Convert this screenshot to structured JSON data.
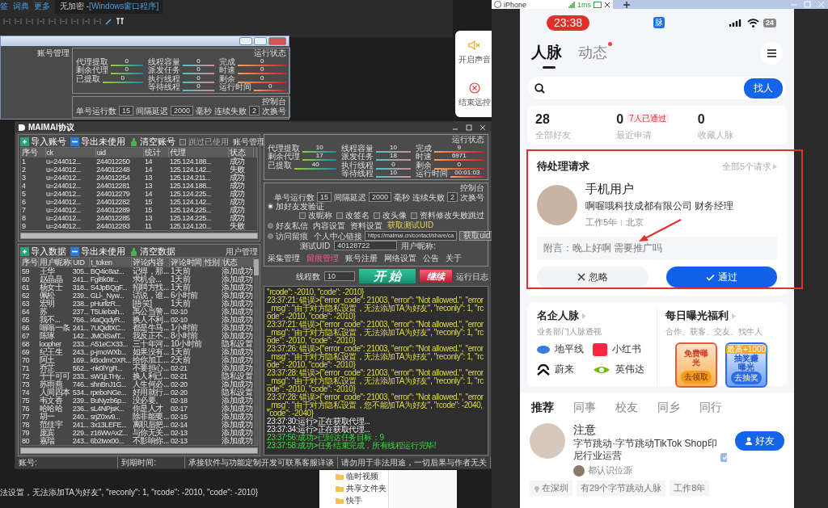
{
  "editor": {
    "menu": [
      "签",
      "词典",
      "更多"
    ],
    "title_prefix": "无加密 - ",
    "title_project": "[Windows窗口程序]"
  },
  "back_window": {
    "section_label": "账号管理",
    "status_title": "运行状态",
    "meters": [
      [
        {
          "label": "代理提取",
          "value": "0"
        },
        {
          "label": "剩余代理",
          "value": "0"
        },
        {
          "label": "已提取",
          "value": "0"
        }
      ],
      [
        {
          "label": "线程容量",
          "value": "0"
        },
        {
          "label": "派发任务",
          "value": "0"
        },
        {
          "label": "执行线程",
          "value": "0"
        },
        {
          "label": "等待线程",
          "value": "0"
        }
      ],
      [
        {
          "label": "完成",
          "value": "0"
        },
        {
          "label": "时速",
          "value": "0"
        },
        {
          "label": "剩余",
          "value": "0"
        },
        {
          "label": "运行时间",
          "value": "0"
        }
      ]
    ],
    "console_title": "控制台",
    "run_count": {
      "label": "单号运行数",
      "value": "15"
    },
    "delay": {
      "label": "间隔延迟",
      "value": "2000",
      "unit": "毫秒"
    },
    "fail": {
      "label": "连续失败",
      "value": "2",
      "unit": "次换号"
    }
  },
  "side_panel": [
    {
      "label": "开启声音",
      "kind": "sound"
    },
    {
      "label": "结束远控",
      "kind": "stop"
    }
  ],
  "maimai": {
    "title": "MAIMAI协议",
    "accounts": {
      "section_label": "账号管理",
      "toolbar": [
        {
          "label": "导入账号",
          "kind": "import"
        },
        {
          "label": "导出未使用",
          "kind": "export"
        },
        {
          "label": "清空账号",
          "kind": "clear"
        }
      ],
      "skip_used": {
        "label": "跳过已使用",
        "checked": false
      },
      "columns": [
        "序号",
        "ck",
        "uid",
        "统计",
        "代理",
        "状态"
      ],
      "rows": [
        [
          "1",
          "u=244012...",
          "244012250",
          "14",
          "125.124.188...",
          "成功"
        ],
        [
          "2",
          "u=244012...",
          "244012248",
          "14",
          "125.124.142...",
          "失败"
        ],
        [
          "3",
          "u=244012...",
          "244012254",
          "13",
          "125.124.211...",
          "成功"
        ],
        [
          "4",
          "u=244012...",
          "244012281",
          "13",
          "125.124.188...",
          "成功"
        ],
        [
          "5",
          "u=244012...",
          "244012279",
          "14",
          "125.124.225...",
          "成功"
        ],
        [
          "6",
          "u=244012...",
          "244012282",
          "15",
          "125.124.142...",
          "成功"
        ],
        [
          "7",
          "u=244012...",
          "244012289",
          "15",
          "125.124.225...",
          "成功"
        ],
        [
          "8",
          "u=244012...",
          "244012285",
          "13",
          "125.124.225...",
          "成功"
        ],
        [
          "9",
          "u=244012...",
          "244012293",
          "11",
          "125.124.120...",
          "失败"
        ]
      ]
    },
    "users": {
      "section_label": "用户管理",
      "toolbar": [
        {
          "label": "导入数据",
          "kind": "import"
        },
        {
          "label": "导出未使用",
          "kind": "export"
        },
        {
          "label": "清空数据",
          "kind": "clear"
        }
      ],
      "columns": [
        "序号",
        "用户昵称",
        "UID",
        "t_token",
        "评论内容",
        "评论时间",
        "性别",
        "状态"
      ],
      "rows": [
        [
          "59",
          "王华",
          "305...",
          "BQ4ic8az...",
          "记得，那...",
          "1天前",
          "添加成功"
        ],
        [
          "60",
          "赵晶晶",
          "241...",
          "Fgl8k0Ir...",
          "求机会...",
          "1天前",
          "添加成功"
        ],
        [
          "61",
          "杨女士",
          "318...",
          "S4JpBQgF...",
          "招聘方找...",
          "1天前",
          "添加成功"
        ],
        [
          "62",
          "佩松",
          "239...",
          "GLl-_Nyw...",
          "话说，谁...",
          "6小时前",
          "添加成功"
        ],
        [
          "63",
          "宏明",
          "238...",
          "pHurllzR...",
          "[捂笑]",
          "1天前",
          "添加成功"
        ],
        [
          "64",
          "苏",
          "237...",
          "T5Uiebah...",
          "禹公当警...",
          "02-10",
          "添加成功"
        ],
        [
          "65",
          "我不...",
          "766...",
          "i4aQqdyR...",
          "换人不利...",
          "02-10",
          "添加成功"
        ],
        [
          "66",
          "嗡嗡一条",
          "241...",
          "7UQidtXC...",
          "都是牛马...",
          "1小时前",
          "添加成功"
        ],
        [
          "67",
          "陈琢",
          "142...",
          "JMOiSwlT...",
          "我反正不...",
          "8小时前",
          "添加成功"
        ],
        [
          "68",
          "loopher",
          "233...",
          "A51eCX33...",
          "三十年河...",
          "10小时前",
          "隐私设置"
        ],
        [
          "69",
          "纪王生",
          "243...",
          "p-jmoWXb...",
          "如果没有...",
          "1天前",
          "添加成功"
        ],
        [
          "70",
          "阿土",
          "169...",
          "kBodmOXR...",
          "给你加工...",
          "2天前",
          "添加成功"
        ],
        [
          "71",
          "乔芷",
          "562...",
          "-nk0lYgR...",
          "不要担心...",
          "02-21",
          "添加成功"
        ],
        [
          "72",
          "千千可可",
          "233...",
          "sW1jLTHy...",
          "换人利己...",
          "02-21",
          "隐私设置"
        ],
        [
          "73",
          "苏雨燕",
          "746...",
          "shnBnJ1G...",
          "人生何必...",
          "02-20",
          "添加成功"
        ],
        [
          "74",
          "人间四本",
          "534...",
          "rpeboNGe...",
          "好用就行...",
          "02-20",
          "隐私设置"
        ],
        [
          "75",
          "韦文香",
          "239...",
          "BuNyzb6p...",
          "没必要。",
          "02-18",
          "添加成功"
        ],
        [
          "76",
          "哈哈哈",
          "236...",
          "sL4NPjsK...",
          "你是人才",
          "02-17",
          "添加成功"
        ],
        [
          "77",
          "胡一",
          "240...",
          "srjZ0xv9...",
          "除非能要...",
          "02-15",
          "添加成功"
        ],
        [
          "78",
          "范佳宇",
          "241...",
          "3x13LEFE...",
          "离职后把...",
          "02-14",
          "添加成功"
        ],
        [
          "79",
          "庞宾",
          "229...",
          "z16WvAxZ...",
          "与你无关...",
          "02-13",
          "添加成功"
        ],
        [
          "80",
          "嘉瑞",
          "243...",
          "6b2twx00...",
          "不影响你...",
          "02-13",
          "添加成功"
        ]
      ]
    },
    "status_title": "运行状态",
    "meters": [
      [
        {
          "label": "代理提取",
          "value": "10"
        },
        {
          "label": "剩余代理",
          "value": "17"
        },
        {
          "label": "已提取",
          "value": "40"
        }
      ],
      [
        {
          "label": "线程容量",
          "value": "10"
        },
        {
          "label": "派发任务",
          "value": "18"
        },
        {
          "label": "执行线程",
          "value": "0"
        },
        {
          "label": "等待线程",
          "value": "10"
        }
      ],
      [
        {
          "label": "完成",
          "value": "9"
        },
        {
          "label": "时速",
          "value": "6971"
        },
        {
          "label": "剩余",
          "value": "0"
        },
        {
          "label": "运行时间",
          "value": "00:01:03"
        }
      ]
    ],
    "console": {
      "title": "控制台",
      "run_count": {
        "label": "单号运行数",
        "value": "15"
      },
      "delay": {
        "label": "间隔延迟",
        "value": "2000",
        "unit": "毫秒"
      },
      "fail": {
        "label": "连续失败",
        "value": "2",
        "unit": "次换号"
      },
      "modes": [
        {
          "label": "加好友发验证",
          "selected": true
        },
        {
          "label": "好友私信",
          "selected": false
        },
        {
          "label": "访问留痕",
          "selected": false
        }
      ],
      "options": [
        {
          "label": "改昵称",
          "checked": false
        },
        {
          "label": "改签名",
          "checked": false
        },
        {
          "label": "改头像",
          "checked": false
        },
        {
          "label": "资料修改失败跳过",
          "checked": false
        }
      ],
      "links": [
        "内容设置",
        "资料设置"
      ],
      "uid_link": "获取测试UID",
      "profile": {
        "label": "个人中心链接",
        "value": "https://maimai.cn/contact/share/ca",
        "button": "获取uid"
      },
      "test_uid": {
        "label": "测试UID",
        "value": "40128722"
      },
      "nickname_label": "用户昵称:",
      "tabs": [
        {
          "label": "采集管理",
          "selected": false
        },
        {
          "label": "留痕管理",
          "selected": true
        },
        {
          "label": "账号注册",
          "selected": false
        },
        {
          "label": "网络设置",
          "selected": false
        },
        {
          "label": "公告",
          "selected": false
        },
        {
          "label": "关于",
          "selected": false
        }
      ]
    },
    "threads": {
      "label": "线程数",
      "value": "10"
    },
    "start_button": "开 始",
    "continue_button": "继续",
    "log_title": "运行日志",
    "log": [
      {
        "kind": "error",
        "text": "\"rcode\": -2010, \"code\": -2010}"
      },
      {
        "kind": "error",
        "text": "23:37:21: 错误>{\"error_code\": 21003, \"error\": \"Not allowed.\", \"error_msg\": \"由于对方隐私设置，无法添加TA为好友\", \"reconly\": 1, \"rcode\": -2010, \"code\": -2010}"
      },
      {
        "kind": "error",
        "text": "23:37:21: 错误>{\"error_code\": 21003, \"error\": \"Not allowed.\", \"error_msg\": \"由于对方隐私设置，无法添加TA为好友\", \"reconly\": 1, \"rcode\": -2010, \"code\": -2010}"
      },
      {
        "kind": "error",
        "text": "23:37:26: 错误>{\"error_code\": 21003, \"error\": \"Not allowed.\", \"error_msg\": \"由于对方隐私设置，无法添加TA为好友\", \"reconly\": 1, \"rcode\": -2010, \"code\": -2010}"
      },
      {
        "kind": "error",
        "text": "23:37:28: 错误>{\"error_code\": 21003, \"error\": \"Not allowed.\", \"error_msg\": \"由于对方隐私设置，无法添加TA为好友\", \"reconly\": 1, \"rcode\": -2010, \"code\": -2010}"
      },
      {
        "kind": "error",
        "text": "23:37:28: 错误>{\"error_code\": 21003, \"error\": \"Not allowed.\", \"error_msg\": \"由于对方隐私设置，您不能加TA为好友\", \"rcode\": -2040, \"code\": -2040}"
      },
      {
        "kind": "run",
        "text": "23:37:30:运行>正在获取代理..."
      },
      {
        "kind": "run",
        "text": "23:37:34:运行>正在获取代理..."
      },
      {
        "kind": "success",
        "text": "23:37:56:成功>已到达任务目标：9"
      },
      {
        "kind": "success",
        "text": "23:37:58:成功>任务结束完成，所有线程运行完毕!"
      }
    ],
    "status_bar": [
      "账号:",
      "到期时间:",
      "承接软件与功能定制开发可联系客服详谈",
      "请勿用于非法用途，一切后果与作者无关"
    ]
  },
  "phone": {
    "tab_title": "iPhone",
    "latency": "1ms",
    "time": "23:38",
    "app_badge": "脉",
    "battery": "24",
    "tabs": [
      {
        "label": "人脉",
        "selected": true,
        "dot": false
      },
      {
        "label": "动态",
        "selected": false,
        "dot": true
      }
    ],
    "search_button": "找人",
    "stats": [
      {
        "value": "28",
        "label": "全部好友"
      },
      {
        "value": "0",
        "label": "最近申请",
        "badge": "7人已通过"
      },
      {
        "value": "0",
        "label": "收藏人脉"
      }
    ],
    "pending": {
      "title": "待处理请求",
      "all_link": "全部5个请求",
      "name": "手机用户",
      "company": "啊喔哦科技成都有限公司 财务经理",
      "years": "工作5年",
      "city": "北京",
      "note": "附言：晚上好啊 需要推广吗",
      "ignore": "忽略",
      "approve": "通过"
    },
    "famous": {
      "title": "名企人脉",
      "subtitle": "业务部门人脉透视",
      "companies": [
        {
          "name": "地平线",
          "kind": "horizon"
        },
        {
          "name": "小红书",
          "kind": "redbook"
        },
        {
          "name": "蔚来",
          "kind": "nio"
        },
        {
          "name": "英伟达",
          "kind": "nvidia"
        }
      ]
    },
    "exposure": {
      "title": "每日曝光福利",
      "subtitle": "合作、获客、交友、找牛人",
      "cards": [
        {
          "kind": "free",
          "label": "免费曝光",
          "button": "去领取"
        },
        {
          "kind": "lottery",
          "label": "抽奖赚曝光",
          "button": "去抽奖",
          "badge": "最高+1000"
        }
      ]
    },
    "feed_tabs": [
      {
        "label": "推荐",
        "selected": true
      },
      {
        "label": "同事",
        "selected": false
      },
      {
        "label": "校友",
        "selected": false
      },
      {
        "label": "同乡",
        "selected": false
      },
      {
        "label": "同行",
        "selected": false
      }
    ],
    "person": {
      "name": "注意",
      "title": "字节跳动·字节跳动TikTok Shop印尼行业运营",
      "mutual": "都认识位源",
      "tags": [
        {
          "kind": "location",
          "label": "在深圳"
        },
        {
          "kind": "plain",
          "label": "有29个字节跳动人脉"
        },
        {
          "kind": "plain",
          "label": "工作8年"
        }
      ],
      "button": "好友"
    }
  },
  "explorer": {
    "folders": [
      "临时视频",
      "共享文件夹",
      "快手"
    ]
  },
  "background_log": [
    "法设置，无法添加TA为好友\", \"reconly\": 1, \"rcode\": -2010, \"code\": -2010}"
  ]
}
